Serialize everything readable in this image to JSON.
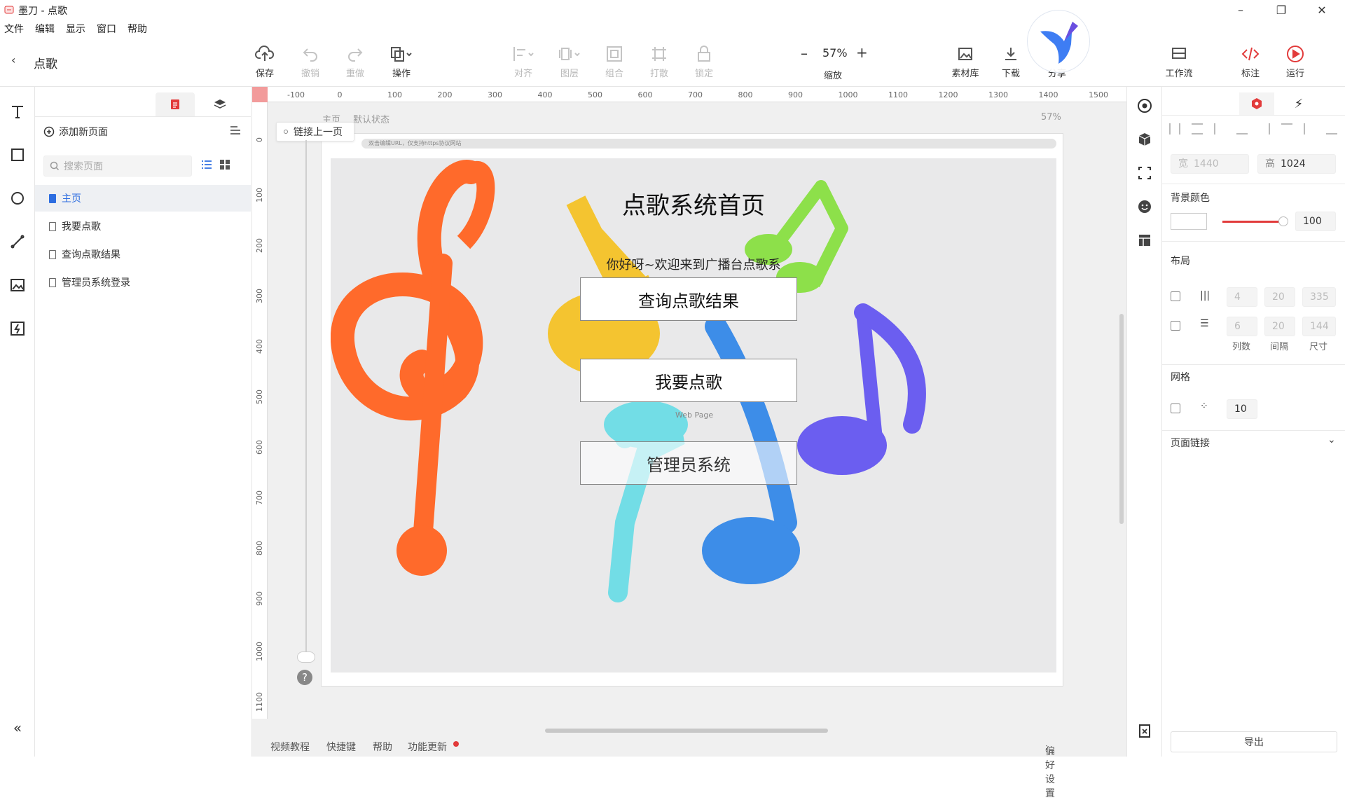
{
  "window": {
    "title": "墨刀 - 点歌"
  },
  "menu": [
    "文件",
    "编辑",
    "显示",
    "窗口",
    "帮助"
  ],
  "header": {
    "back_label": "点歌"
  },
  "toolbar": {
    "save": "保存",
    "undo": "撤销",
    "redo": "重做",
    "operate": "操作",
    "align": "对齐",
    "layer": "图层",
    "group": "组合",
    "ungroup": "打散",
    "lock": "锁定",
    "zoom_value": "57%",
    "zoom_label": "缩放",
    "assets": "素材库",
    "download": "下载",
    "share": "分享",
    "workflow": "工作流",
    "annotate": "标注",
    "run": "运行"
  },
  "pages_panel": {
    "add_page": "添加新页面",
    "search_placeholder": "搜索页面",
    "pages": [
      "主页",
      "我要点歌",
      "查询点歌结果",
      "管理员系统登录"
    ],
    "active_index": 0
  },
  "canvas": {
    "breadcrumb_page": "主页",
    "breadcrumb_state": "默认状态",
    "zoom_readout": "57%",
    "link_prev": "链接上一页",
    "url_hint": "双击编辑URL，仅支持https协议网站",
    "ruler_top": [
      "-100",
      "0",
      "100",
      "200",
      "300",
      "400",
      "500",
      "600",
      "700",
      "800",
      "900",
      "1000",
      "1100",
      "1200",
      "1300",
      "1400",
      "1500"
    ],
    "ruler_left": [
      "0",
      "100",
      "200",
      "300",
      "400",
      "500",
      "600",
      "700",
      "800",
      "900",
      "1000",
      "1100"
    ],
    "help": "?"
  },
  "page_content": {
    "title": "点歌系统首页",
    "subtitle": "你好呀~欢迎来到广播台点歌系统，您想做些什么呢?",
    "btn_query": "查询点歌结果",
    "btn_request": "我要点歌",
    "btn_admin": "管理员系统",
    "webpage_label": "Web Page"
  },
  "props": {
    "width": "1440",
    "height_label": "高",
    "height": "1024",
    "width_label": "宽",
    "bg_label": "背景颜色",
    "opacity": "100",
    "layout_label": "布局",
    "cols_row": [
      "4",
      "20",
      "335"
    ],
    "rows_row": [
      "6",
      "20",
      "144"
    ],
    "col_headers": [
      "列数",
      "间隔",
      "尺寸"
    ],
    "grid_label": "网格",
    "grid_value": "10",
    "page_link": "页面链接",
    "export": "导出"
  },
  "bottom": {
    "video": "视频教程",
    "shortcut": "快捷键",
    "help": "帮助",
    "updates": "功能更新",
    "prefs": "偏好设置"
  },
  "colors": {
    "accent": "#2d6de0",
    "red": "#e23b3b",
    "orange_note": "#ff6a2b",
    "yellow_note": "#f4c430",
    "green_note": "#8de04a",
    "blue_note": "#3d8de8",
    "purple_note": "#6b5ef0",
    "cyan_note": "#72dde6"
  }
}
